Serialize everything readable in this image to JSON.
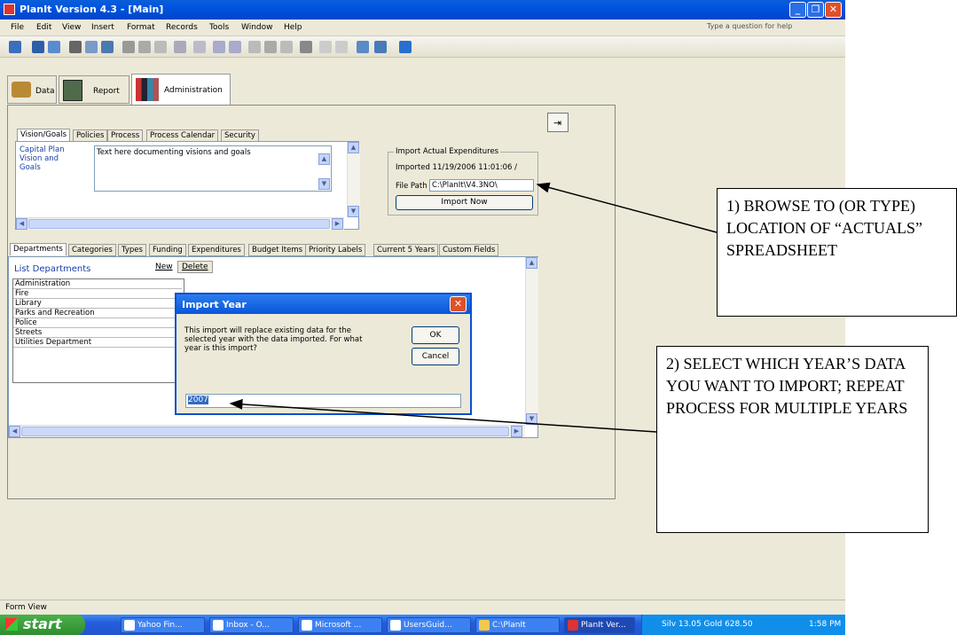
{
  "window": {
    "title": "PlanIt Version 4.3 - [Main]"
  },
  "menu": [
    "File",
    "Edit",
    "View",
    "Insert",
    "Format",
    "Records",
    "Tools",
    "Window",
    "Help"
  ],
  "help_placeholder": "Type a question for help",
  "main_tabs": [
    "Data",
    "Report",
    "Administration"
  ],
  "admin_tabs": [
    "Vision/Goals",
    "Policies",
    "Process",
    "Process Calendar",
    "Security"
  ],
  "vision": {
    "label": "Capital Plan Vision and Goals",
    "text": "Text here documenting visions and goals"
  },
  "import_group": {
    "title": "Import Actual Expenditures",
    "imported": "Imported 11/19/2006 11:01:06 /",
    "file_path_label": "File Path",
    "file_path_value": "C:\\PlanIt\\V4.3NO\\",
    "import_button": "Import Now"
  },
  "data_tabs": [
    "Departments",
    "Categories",
    "Types",
    "Funding",
    "Expenditures",
    "Budget Items",
    "Priority Labels",
    "Current 5 Years",
    "Custom Fields"
  ],
  "departments": {
    "title": "List Departments",
    "new_button": "New",
    "delete_button": "Delete",
    "items": [
      "Administration",
      "Fire",
      "Library",
      "Parks and Recreation",
      "Police",
      "Streets",
      "Utilities Department"
    ]
  },
  "dialog": {
    "title": "Import Year",
    "message": "This import will replace existing data for the selected year with the data imported.  For what year is this import?",
    "ok": "OK",
    "cancel": "Cancel",
    "value": "2007"
  },
  "callouts": {
    "first": "1) BROWSE  TO (OR TYPE) LOCATION OF “ACTUALS” SPREADSHEET",
    "second": "2) SELECT WHICH YEAR’S DATA YOU WANT TO IMPORT; REPEAT PROCESS FOR MULTIPLE YEARS"
  },
  "status": "Form View",
  "taskbar": {
    "start": "start",
    "tasks": [
      "Yahoo Fin...",
      "Inbox - O...",
      "Microsoft ...",
      "UsersGuid...",
      "C:\\PlanIt",
      "PlanIt Ver..."
    ],
    "tray": "Silv 13.05 Gold 628.50",
    "time": "1:58 PM"
  }
}
